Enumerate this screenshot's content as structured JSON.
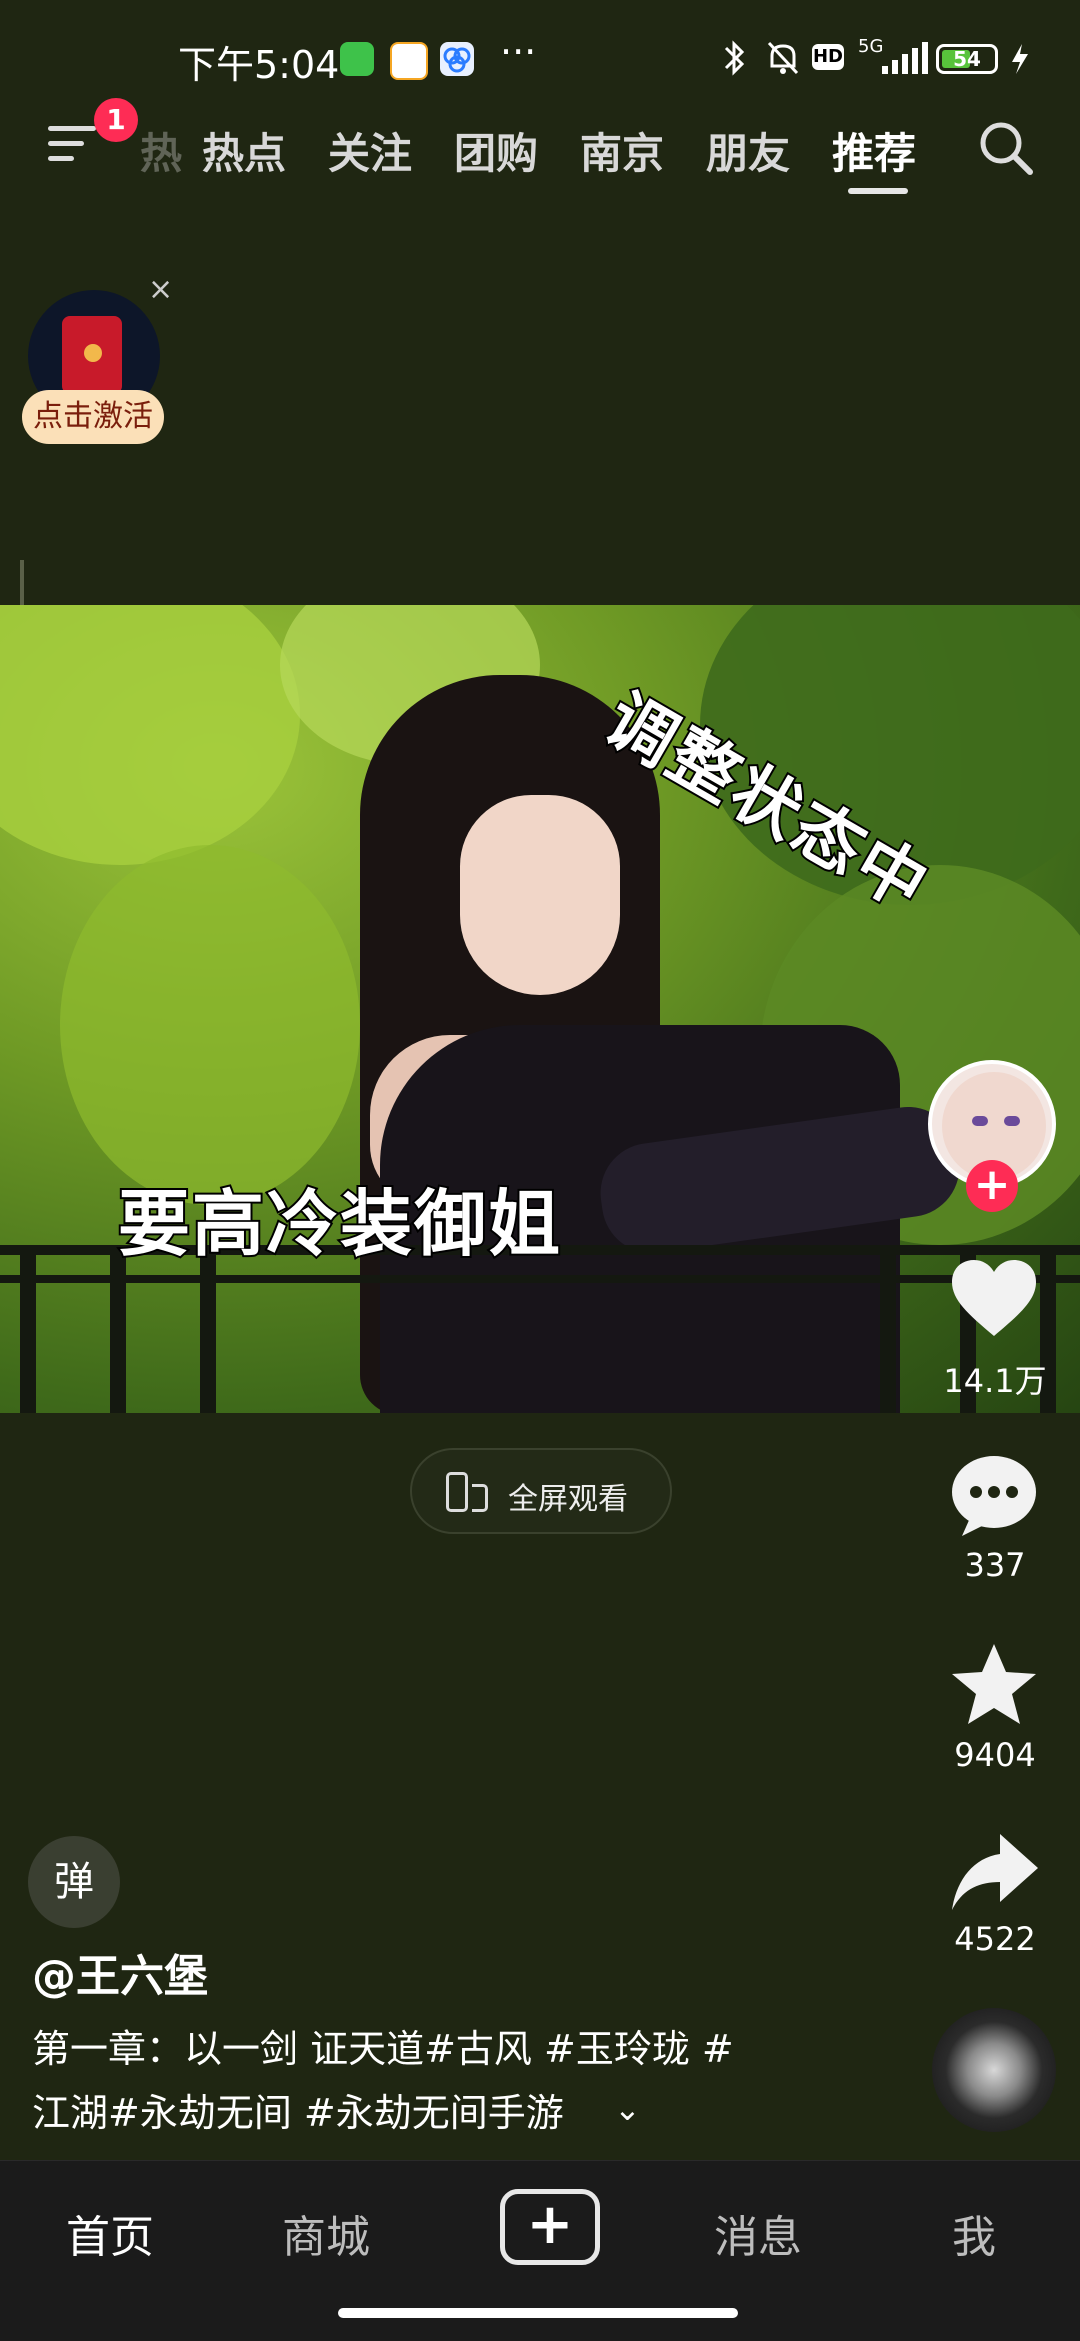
{
  "status_bar": {
    "time": "下午5:04",
    "more": "···",
    "network": "5G",
    "hd": "HD",
    "battery": "54"
  },
  "top_nav": {
    "badge_count": "1",
    "partial_tab": "热",
    "tabs": [
      "热点",
      "关注",
      "团购",
      "南京",
      "朋友",
      "推荐"
    ],
    "active_tab": "推荐"
  },
  "red_packet": {
    "close": "×",
    "label": "点击激活"
  },
  "video": {
    "caption_left": "要高冷装御姐",
    "caption_right": "调整状态中",
    "fullscreen_label": "全屏观看"
  },
  "actions": {
    "follow": "+",
    "likes": "14.1万",
    "comments": "337",
    "favorites": "9404",
    "shares": "4522"
  },
  "post": {
    "danmu": "弹",
    "author": "@王六堡",
    "desc_line1": "第一章：以一剑 证天道#古风 #玉玲珑  #",
    "desc_line2": "江湖#永劫无间 #永劫无间手游",
    "expand": "⌄"
  },
  "bottom_nav": {
    "items": [
      "首页",
      "商城",
      "消息",
      "我"
    ],
    "plus": "+"
  },
  "colors": {
    "background": "#1f2612",
    "accent": "#fe2c55",
    "bottom_bar": "#1b1b1b"
  }
}
